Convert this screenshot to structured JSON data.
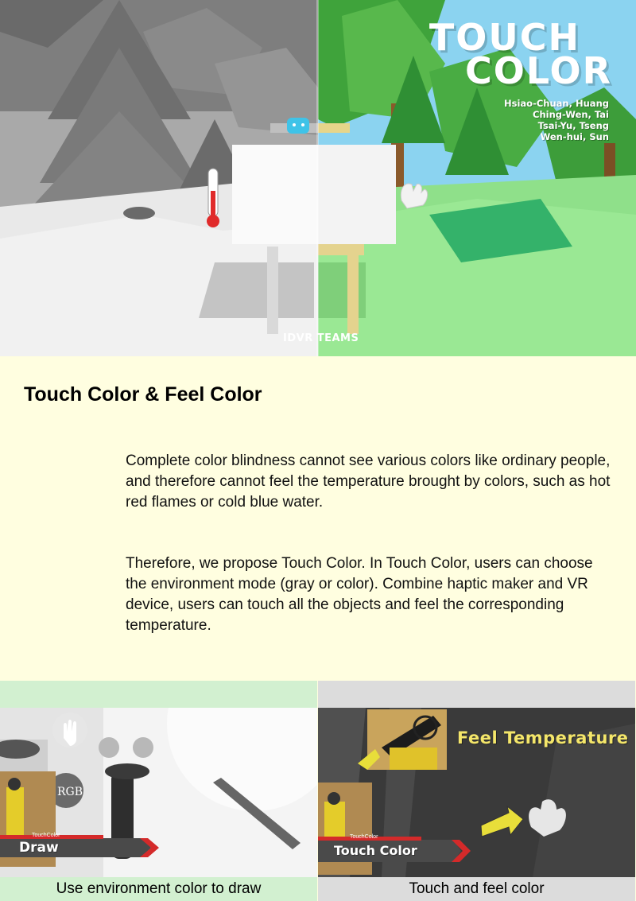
{
  "hero": {
    "title_line1": "TOUCH",
    "title_line2": "COLOR",
    "authors": [
      "Hsiao-Chuan, Huang",
      "Ching-Wen, Tai",
      "Tsai-Yu, Tseng",
      "Wen-hui, Sun"
    ],
    "team": "IDVR TEAMS"
  },
  "intro": {
    "title": "Touch Color & Feel Color",
    "paragraph1": "Complete color blindness cannot see various colors like ordinary people, and therefore cannot feel the temperature brought by colors, such as hot red flames or cold blue water.",
    "paragraph2": "Therefore, we propose Touch Color. In Touch Color, users can choose the environment mode (gray or color). Combine haptic maker and VR device, users can touch all the objects and feel the corresponding temperature."
  },
  "demos": [
    {
      "tag_small": "TouchColor",
      "tag": "Draw",
      "button_label": "RGB",
      "caption": "Use environment color to draw"
    },
    {
      "tag_small": "TouchColor",
      "tag": "Touch Color",
      "overlay_title": "Feel Temperature",
      "caption": "Touch and feel color"
    }
  ],
  "colors": {
    "panel_bg": "#fffee0",
    "left_caption_bg": "#d2f0d0",
    "right_caption_bg": "#dcdcdc",
    "accent_yellow": "#f4e66a",
    "tag_red": "#d42a2a"
  }
}
